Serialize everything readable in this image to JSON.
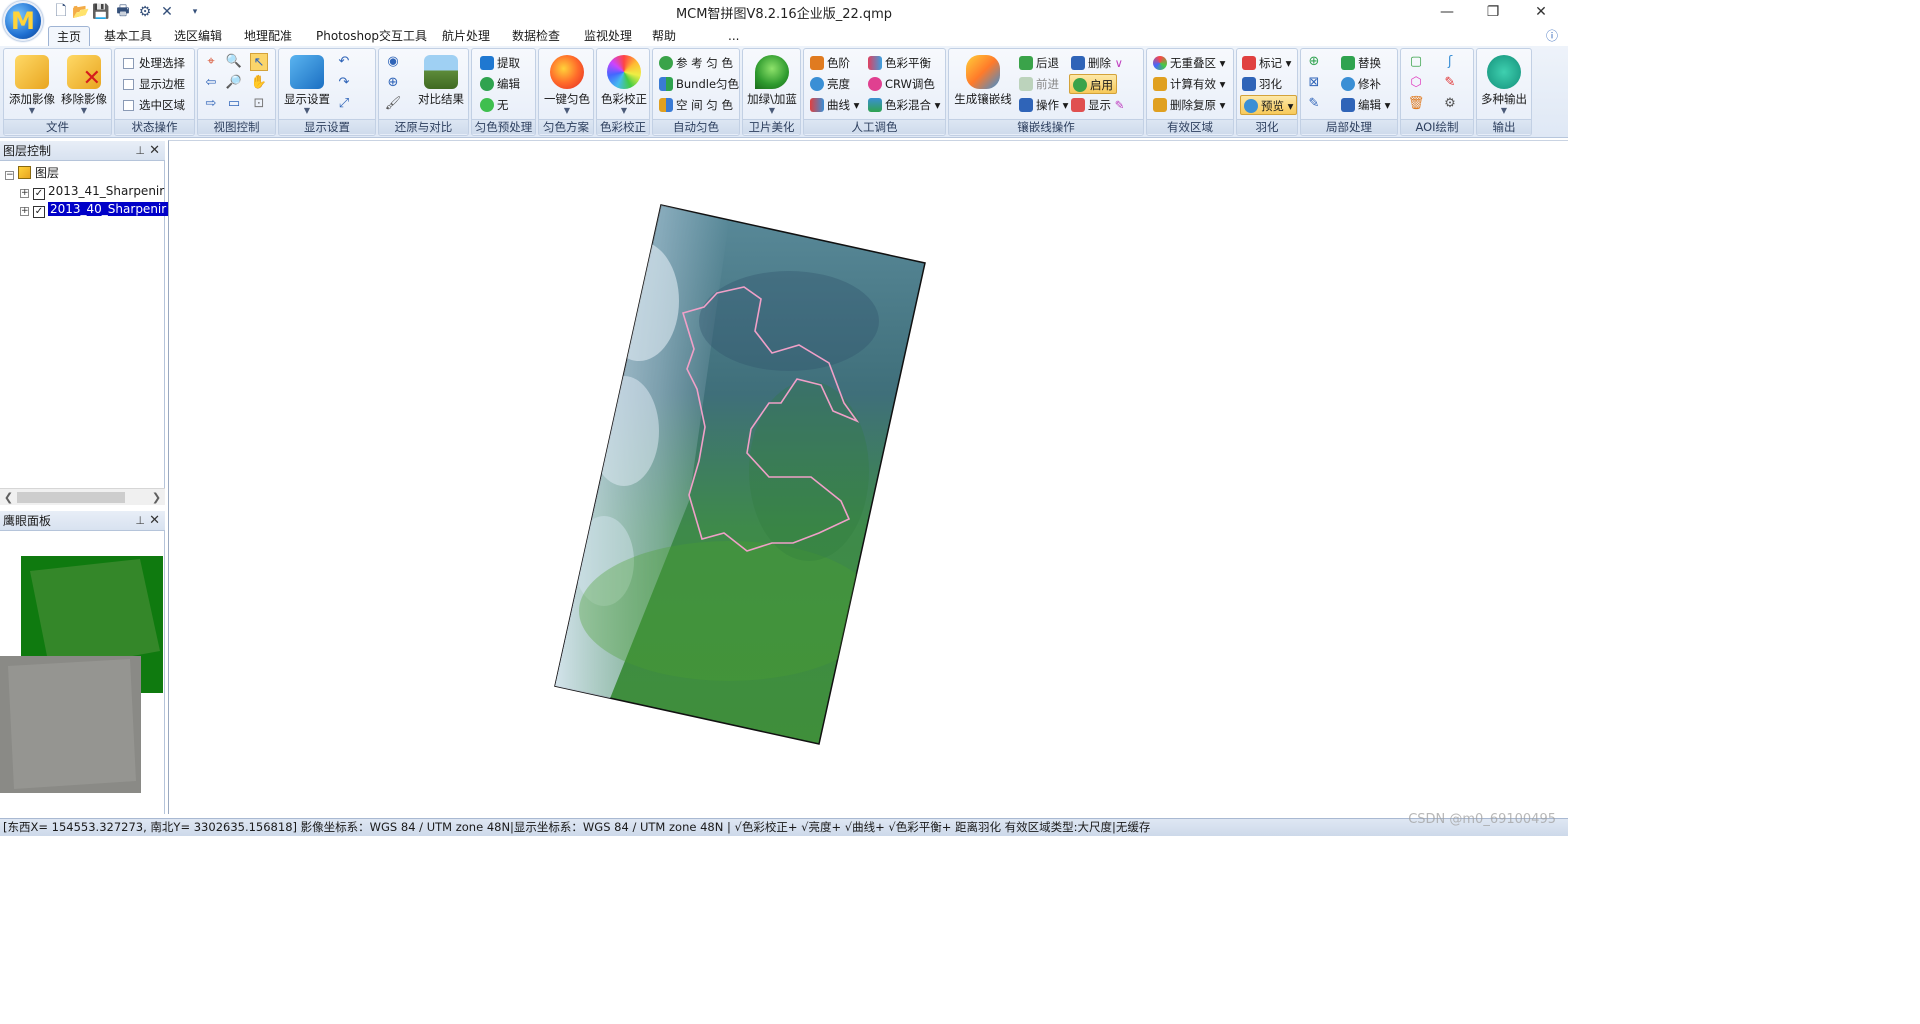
{
  "window": {
    "title": "MCM智拼图V8.2.16企业版_22.qmp",
    "logo_letter": "M",
    "min": "—",
    "restore": "❐",
    "close": "✕"
  },
  "tabs": [
    "主页",
    "基本工具",
    "选区编辑",
    "地理配准",
    "Photoshop交互工具",
    "航片处理",
    "数据检查",
    "监视处理",
    "帮助",
    "..."
  ],
  "ribbon": {
    "file": {
      "label": "文件",
      "add": "添加影像",
      "remove": "移除影像"
    },
    "state": {
      "label": "状态操作",
      "items": [
        "处理选择",
        "显示边框",
        "选中区域"
      ]
    },
    "view": {
      "label": "视图控制"
    },
    "display": {
      "label": "显示设置",
      "btn": "显示设置"
    },
    "restore": {
      "label": "还原与对比",
      "btn": "对比结果"
    },
    "pre": {
      "label": "匀色预处理",
      "items": [
        "提取",
        "编辑",
        "无"
      ]
    },
    "scheme": {
      "label": "匀色方案",
      "btn": "一键匀色"
    },
    "color_correct": {
      "label": "色彩校正",
      "btn": "色彩校正"
    },
    "auto": {
      "label": "自动匀色",
      "items": [
        "参 考 匀 色",
        "Bundle匀色",
        "空 间 匀 色"
      ]
    },
    "sat": {
      "label": "卫片美化",
      "btn": "加绿\\加蓝"
    },
    "manual": {
      "label": "人工调色",
      "items": [
        "色阶",
        "亮度",
        "曲线",
        "色彩平衡",
        "CRW调色",
        "色彩混合"
      ]
    },
    "seam": {
      "label": "镶嵌线操作",
      "btn": "生成镶嵌线",
      "items": [
        "后退",
        "前进",
        "操作",
        "删除",
        "启用",
        "显示"
      ]
    },
    "valid": {
      "label": "有效区域",
      "items": [
        "无重叠区",
        "计算有效",
        "删除复原"
      ]
    },
    "feather": {
      "label": "羽化",
      "items": [
        "标记",
        "羽化",
        "预览"
      ]
    },
    "local": {
      "label": "局部处理",
      "items": [
        "替换",
        "修补",
        "编辑"
      ]
    },
    "aoi": {
      "label": "AOI绘制"
    },
    "output": {
      "label": "输出",
      "btn": "多种输出"
    }
  },
  "layer_panel": {
    "title": "图层控制",
    "root": "图层",
    "layers": [
      {
        "name": "2013_41_Sharpenir",
        "checked": "✓",
        "selected": false
      },
      {
        "name": "2013_40_Sharpenir",
        "checked": "✓",
        "selected": true
      }
    ]
  },
  "eagle_panel": {
    "title": "鹰眼面板"
  },
  "statusbar": {
    "text": "[东西X= 154553.327273, 南北Y= 3302635.156818] 影像坐标系：WGS 84 / UTM zone 48N|显示坐标系：WGS 84 / UTM zone 48N | √色彩校正+ √亮度+ √曲线+ √色彩平衡+ 距离羽化 有效区域类型:大尺度|无缓存"
  },
  "watermark": "CSDN @m0_69100495",
  "colors": {
    "accent": "#2f64b8",
    "selection": "#0000c8",
    "boundary": "#f0a0c8"
  }
}
